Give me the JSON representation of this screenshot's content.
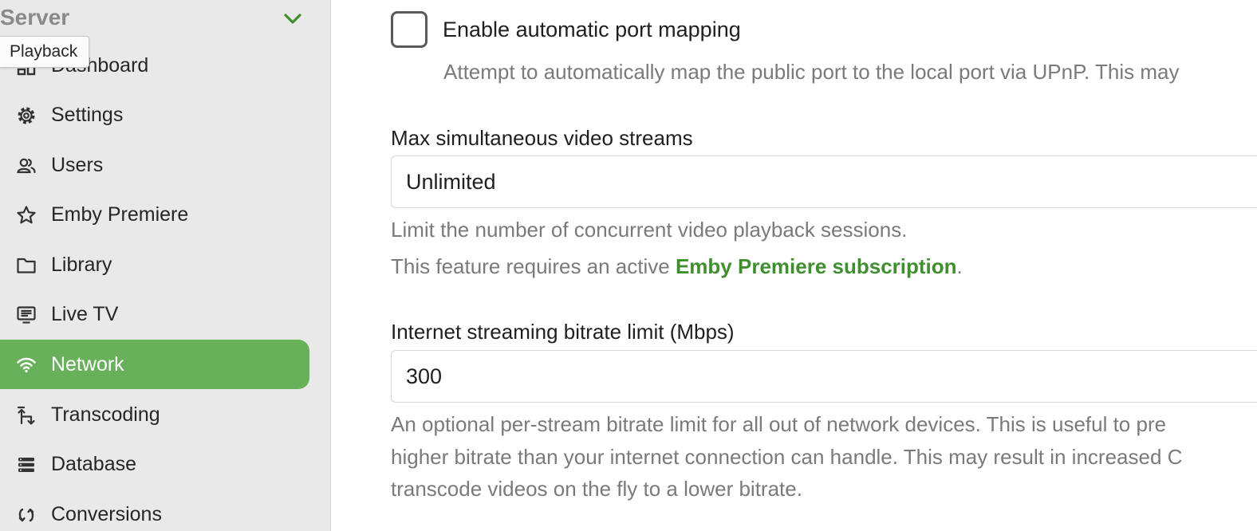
{
  "sidebar": {
    "section_title": "Server",
    "tooltip": "Playback",
    "items": [
      {
        "label": "Dashboard",
        "icon": "dashboard-icon"
      },
      {
        "label": "Settings",
        "icon": "gear-icon"
      },
      {
        "label": "Users",
        "icon": "users-icon"
      },
      {
        "label": "Emby Premiere",
        "icon": "star-icon"
      },
      {
        "label": "Library",
        "icon": "folder-icon"
      },
      {
        "label": "Live TV",
        "icon": "tv-guide-icon"
      },
      {
        "label": "Network",
        "icon": "wifi-icon",
        "active": true
      },
      {
        "label": "Transcoding",
        "icon": "transcode-icon"
      },
      {
        "label": "Database",
        "icon": "database-icon"
      },
      {
        "label": "Conversions",
        "icon": "conversions-icon"
      }
    ]
  },
  "main": {
    "upnp": {
      "checked": false,
      "label": "Enable automatic port mapping",
      "description": "Attempt to automatically map the public port to the local port via UPnP. This may"
    },
    "max_streams": {
      "label": "Max simultaneous video streams",
      "value": "Unlimited",
      "help": "Limit the number of concurrent video playback sessions.",
      "premiere_prefix": "This feature requires an active ",
      "premiere_link": "Emby Premiere subscription",
      "premiere_suffix": "."
    },
    "bitrate": {
      "label": "Internet streaming bitrate limit (Mbps)",
      "value": "300",
      "help_line1": "An optional per-stream bitrate limit for all out of network devices. This is useful to pre",
      "help_line2": "higher bitrate than your internet connection can handle. This may result in increased C",
      "help_line3": "transcode videos on the fly to a lower bitrate."
    }
  },
  "colors": {
    "accent": "#68b05a",
    "link": "#3f8f2f",
    "sidebar_bg": "#e9e9e9"
  }
}
